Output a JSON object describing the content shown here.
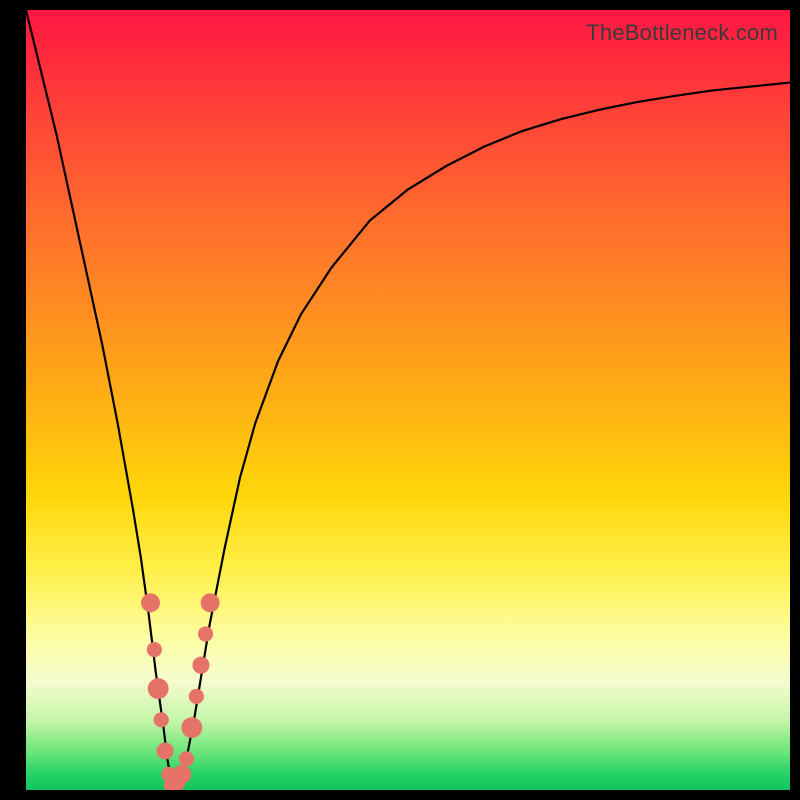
{
  "attribution": "TheBottleneck.com",
  "chart_data": {
    "type": "line",
    "title": "",
    "xlabel": "",
    "ylabel": "",
    "xlim": [
      0,
      100
    ],
    "ylim": [
      0,
      100
    ],
    "grid": false,
    "legend": false,
    "series": [
      {
        "name": "bottleneck-curve",
        "x": [
          0,
          2,
          4,
          6,
          8,
          10,
          12,
          14,
          15,
          16,
          17,
          18,
          18.5,
          19,
          19.5,
          20,
          21,
          22,
          23,
          24,
          26,
          28,
          30,
          33,
          36,
          40,
          45,
          50,
          55,
          60,
          65,
          70,
          75,
          80,
          85,
          90,
          95,
          100
        ],
        "y": [
          100,
          92,
          84,
          75,
          66,
          57,
          47,
          36,
          30,
          23,
          15,
          8,
          4,
          1,
          0.3,
          1,
          4,
          9,
          15,
          21,
          31,
          40,
          47,
          55,
          61,
          67,
          73,
          77,
          80,
          82.5,
          84.5,
          86,
          87.2,
          88.2,
          89,
          89.7,
          90.2,
          90.7
        ]
      }
    ],
    "markers": {
      "name": "highlighted-points",
      "color": "#e57368",
      "points": [
        {
          "x": 16.3,
          "y": 24,
          "r": 2.0
        },
        {
          "x": 16.8,
          "y": 18,
          "r": 1.6
        },
        {
          "x": 17.3,
          "y": 13,
          "r": 2.2
        },
        {
          "x": 17.7,
          "y": 9,
          "r": 1.6
        },
        {
          "x": 18.2,
          "y": 5,
          "r": 1.8
        },
        {
          "x": 18.7,
          "y": 2,
          "r": 1.6
        },
        {
          "x": 19.3,
          "y": 0.6,
          "r": 2.0
        },
        {
          "x": 19.8,
          "y": 0.8,
          "r": 1.6
        },
        {
          "x": 20.4,
          "y": 2,
          "r": 2.0
        },
        {
          "x": 21.0,
          "y": 4,
          "r": 1.6
        },
        {
          "x": 21.7,
          "y": 8,
          "r": 2.2
        },
        {
          "x": 22.3,
          "y": 12,
          "r": 1.6
        },
        {
          "x": 22.9,
          "y": 16,
          "r": 1.8
        },
        {
          "x": 23.5,
          "y": 20,
          "r": 1.6
        },
        {
          "x": 24.1,
          "y": 24,
          "r": 2.0
        }
      ]
    },
    "gradient_stops": [
      {
        "pos": 0.0,
        "color": "#ff1744"
      },
      {
        "pos": 0.14,
        "color": "#ff4538"
      },
      {
        "pos": 0.38,
        "color": "#ff8c22"
      },
      {
        "pos": 0.62,
        "color": "#ffd60a"
      },
      {
        "pos": 0.8,
        "color": "#fdfd9e"
      },
      {
        "pos": 0.91,
        "color": "#c6f5a8"
      },
      {
        "pos": 1.0,
        "color": "#10c45e"
      }
    ]
  }
}
